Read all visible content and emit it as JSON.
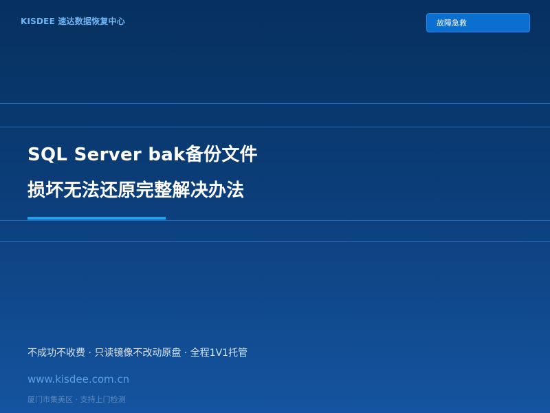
{
  "header": {
    "brand": "KISDEE 速达数据恢复中心",
    "emergency_button": "故障急救"
  },
  "hero": {
    "title_line1": "SQL Server bak备份文件",
    "title_line2": "损坏无法还原完整解决办法"
  },
  "footer": {
    "tagline": "不成功不收费 · 只读镜像不改动原盘 · 全程1V1托管",
    "website": "www.kisdee.com.cn",
    "note": "厦门市集美区 · 支持上门检测"
  },
  "colors": {
    "background_top": "#06305e",
    "background_bottom": "#1554a0",
    "accent": "#1aa2f0",
    "button": "#0b6fcf"
  }
}
